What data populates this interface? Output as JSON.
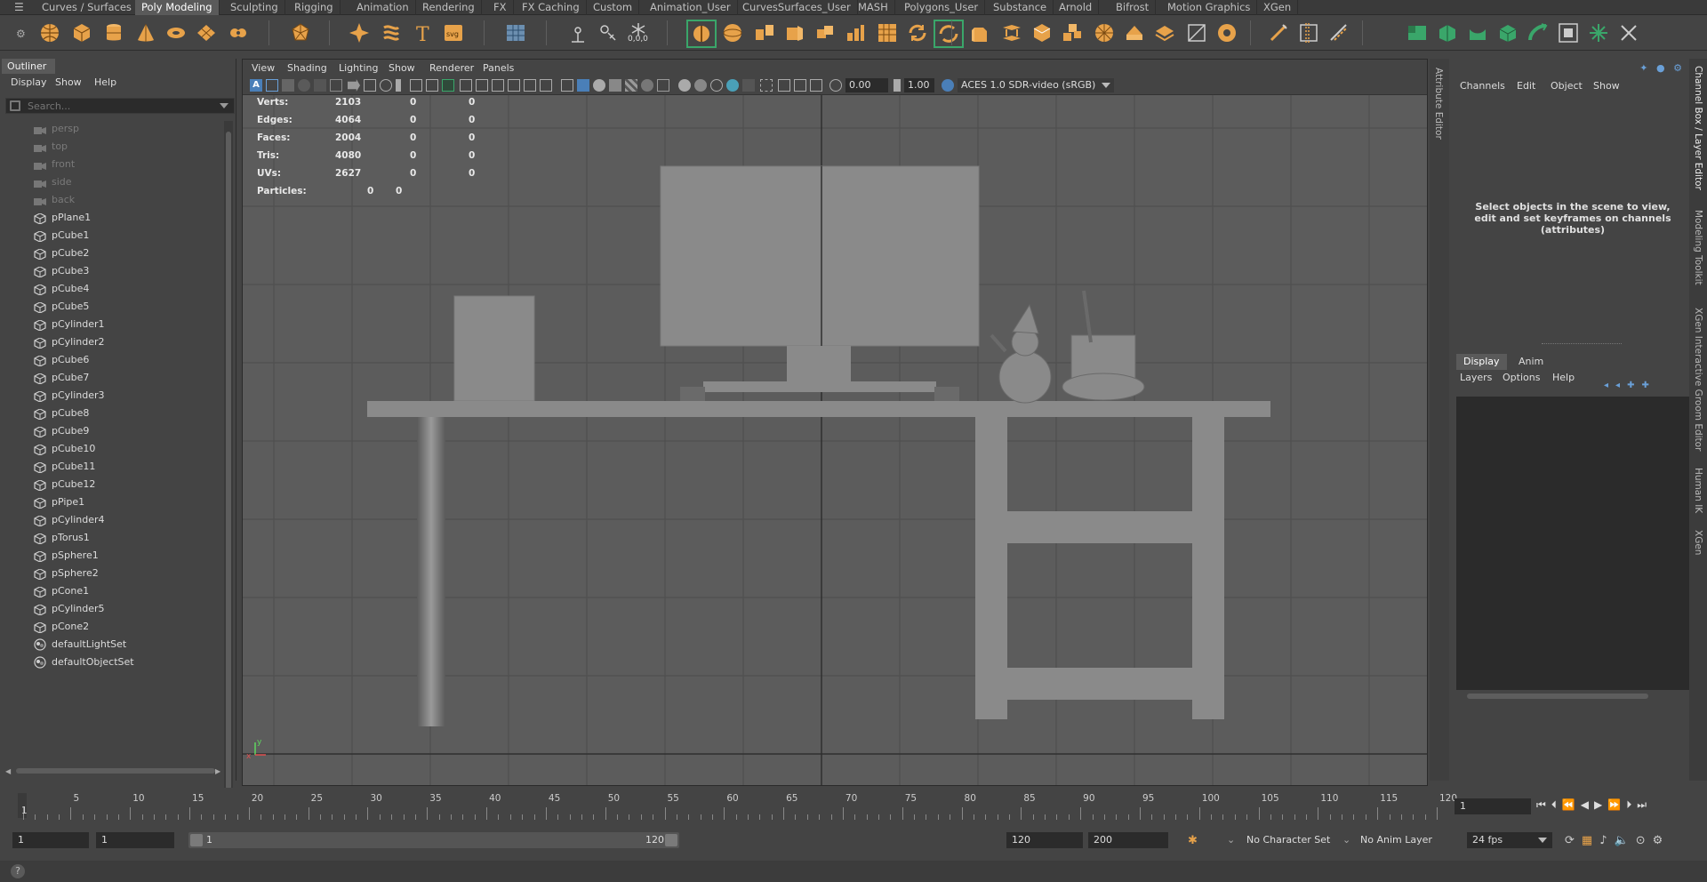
{
  "shelf": {
    "tabs": [
      {
        "label": "Curves / Surfaces",
        "active": false
      },
      {
        "label": "Poly Modeling",
        "active": true
      },
      {
        "label": "Sculpting",
        "active": false
      },
      {
        "label": "Rigging",
        "active": false
      },
      {
        "label": "Animation",
        "active": false
      },
      {
        "label": "Rendering",
        "active": false
      },
      {
        "label": "FX",
        "active": false
      },
      {
        "label": "FX Caching",
        "active": false
      },
      {
        "label": "Custom",
        "active": false
      },
      {
        "label": "Animation_User",
        "active": false
      },
      {
        "label": "CurvesSurfaces_User",
        "active": false
      },
      {
        "label": "MASH",
        "active": false
      },
      {
        "label": "Polygons_User",
        "active": false
      },
      {
        "label": "Substance",
        "active": false
      },
      {
        "label": "Arnold",
        "active": false
      },
      {
        "label": "Bifrost",
        "active": false
      },
      {
        "label": "Motion Graphics",
        "active": false
      },
      {
        "label": "XGen",
        "active": false
      }
    ],
    "icon_svg_label": "svg",
    "icon_coords_label": "0,0,0",
    "accent_color": "#e7a24a",
    "green_color": "#3aa66a"
  },
  "outliner": {
    "tab": "Outliner",
    "menu": [
      "Display",
      "Show",
      "Help"
    ],
    "search_placeholder": "Search...",
    "items": [
      {
        "label": "persp",
        "type": "camera",
        "dim": true
      },
      {
        "label": "top",
        "type": "camera",
        "dim": true
      },
      {
        "label": "front",
        "type": "camera",
        "dim": true
      },
      {
        "label": "side",
        "type": "camera",
        "dim": true
      },
      {
        "label": "back",
        "type": "camera",
        "dim": true
      },
      {
        "label": "pPlane1",
        "type": "mesh",
        "dim": false
      },
      {
        "label": "pCube1",
        "type": "mesh",
        "dim": false
      },
      {
        "label": "pCube2",
        "type": "mesh",
        "dim": false
      },
      {
        "label": "pCube3",
        "type": "mesh",
        "dim": false
      },
      {
        "label": "pCube4",
        "type": "mesh",
        "dim": false
      },
      {
        "label": "pCube5",
        "type": "mesh",
        "dim": false
      },
      {
        "label": "pCylinder1",
        "type": "mesh",
        "dim": false
      },
      {
        "label": "pCylinder2",
        "type": "mesh",
        "dim": false
      },
      {
        "label": "pCube6",
        "type": "mesh",
        "dim": false
      },
      {
        "label": "pCube7",
        "type": "mesh",
        "dim": false
      },
      {
        "label": "pCylinder3",
        "type": "mesh",
        "dim": false
      },
      {
        "label": "pCube8",
        "type": "mesh",
        "dim": false
      },
      {
        "label": "pCube9",
        "type": "mesh",
        "dim": false
      },
      {
        "label": "pCube10",
        "type": "mesh",
        "dim": false
      },
      {
        "label": "pCube11",
        "type": "mesh",
        "dim": false
      },
      {
        "label": "pCube12",
        "type": "mesh",
        "dim": false
      },
      {
        "label": "pPipe1",
        "type": "mesh",
        "dim": false
      },
      {
        "label": "pCylinder4",
        "type": "mesh",
        "dim": false
      },
      {
        "label": "pTorus1",
        "type": "mesh",
        "dim": false
      },
      {
        "label": "pSphere1",
        "type": "mesh",
        "dim": false
      },
      {
        "label": "pSphere2",
        "type": "mesh",
        "dim": false
      },
      {
        "label": "pCone1",
        "type": "mesh",
        "dim": false
      },
      {
        "label": "pCylinder5",
        "type": "mesh",
        "dim": false
      },
      {
        "label": "pCone2",
        "type": "mesh",
        "dim": false
      },
      {
        "label": "defaultLightSet",
        "type": "set",
        "dim": false
      },
      {
        "label": "defaultObjectSet",
        "type": "set",
        "dim": false
      }
    ]
  },
  "viewport": {
    "menu": [
      "View",
      "Shading",
      "Lighting",
      "Show",
      "Renderer",
      "Panels"
    ],
    "exposure": "0.00",
    "gamma": "1.00",
    "color_space": "ACES 1.0 SDR-video (sRGB)",
    "hud": {
      "rows": [
        {
          "label": "Verts:",
          "a": "2103",
          "b": "0",
          "c": "0"
        },
        {
          "label": "Edges:",
          "a": "4064",
          "b": "0",
          "c": "0"
        },
        {
          "label": "Faces:",
          "a": "2004",
          "b": "0",
          "c": "0"
        },
        {
          "label": "Tris:",
          "a": "4080",
          "b": "0",
          "c": "0"
        },
        {
          "label": "UVs:",
          "a": "2627",
          "b": "0",
          "c": "0"
        }
      ],
      "particles_label": "Particles:",
      "particles_a": "0",
      "particles_b": "0"
    },
    "axis_y": "y",
    "axis_x": "x"
  },
  "channelbox": {
    "menu": [
      "Channels",
      "Edit",
      "Object",
      "Show"
    ],
    "message": "Select objects in the scene to view, edit and set keyframes on channels (attributes)",
    "layer_tabs": [
      "Display",
      "Anim"
    ],
    "layer_menu": [
      "Layers",
      "Options",
      "Help"
    ]
  },
  "side_tabs": [
    "Attribute Editor",
    "Channel Box / Layer Editor",
    "Modeling Toolkit",
    "XGen Interactive Groom Editor",
    "Human IK",
    "XGen"
  ],
  "timeline": {
    "tick_labels": [
      "1",
      "5",
      "10",
      "15",
      "20",
      "25",
      "30",
      "35",
      "40",
      "45",
      "50",
      "55",
      "60",
      "65",
      "70",
      "75",
      "80",
      "85",
      "90",
      "95",
      "100",
      "105",
      "110",
      "115",
      "120"
    ],
    "current_frame": "1"
  },
  "range": {
    "start_frame": "1",
    "playback_start": "1",
    "range_start_label": "1",
    "range_end_label": "120",
    "playback_end": "120",
    "animation_end": "200",
    "character_set": "No Character Set",
    "anim_layer": "No Anim Layer",
    "fps": "24 fps"
  }
}
